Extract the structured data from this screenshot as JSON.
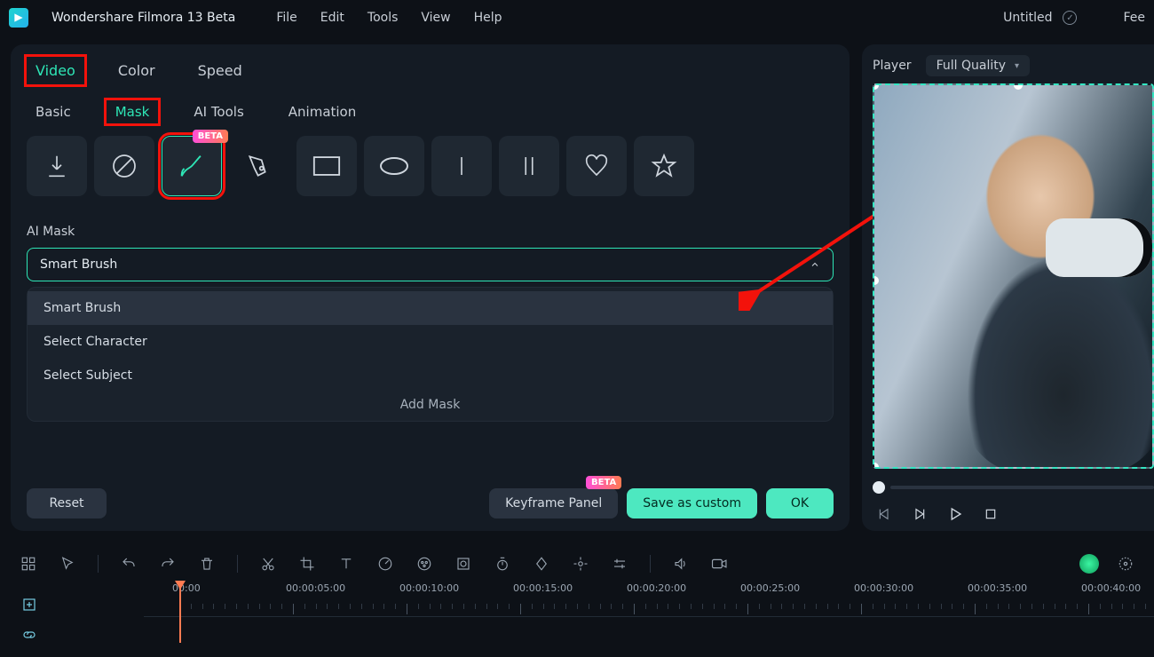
{
  "app": {
    "name": "Wondershare Filmora 13 Beta"
  },
  "menu": {
    "file": "File",
    "edit": "Edit",
    "tools": "Tools",
    "view": "View",
    "help": "Help"
  },
  "doc": {
    "title": "Untitled",
    "feedback": "Fee"
  },
  "tabs": {
    "video": "Video",
    "color": "Color",
    "speed": "Speed"
  },
  "subtabs": {
    "basic": "Basic",
    "mask": "Mask",
    "ai": "AI Tools",
    "anim": "Animation"
  },
  "mask_icons": {
    "beta": "BETA"
  },
  "ai_mask": {
    "label": "AI Mask",
    "selected": "Smart Brush",
    "options": [
      "Smart Brush",
      "Select Character",
      "Select Subject"
    ],
    "add": "Add Mask"
  },
  "footer": {
    "reset": "Reset",
    "kf": "Keyframe Panel",
    "kf_beta": "BETA",
    "save": "Save as custom",
    "ok": "OK"
  },
  "preview": {
    "player": "Player",
    "quality": "Full Quality"
  },
  "timeline": {
    "labels": [
      "00:00",
      "00:00:05:00",
      "00:00:10:00",
      "00:00:15:00",
      "00:00:20:00",
      "00:00:25:00",
      "00:00:30:00",
      "00:00:35:00",
      "00:00:40:00"
    ]
  }
}
